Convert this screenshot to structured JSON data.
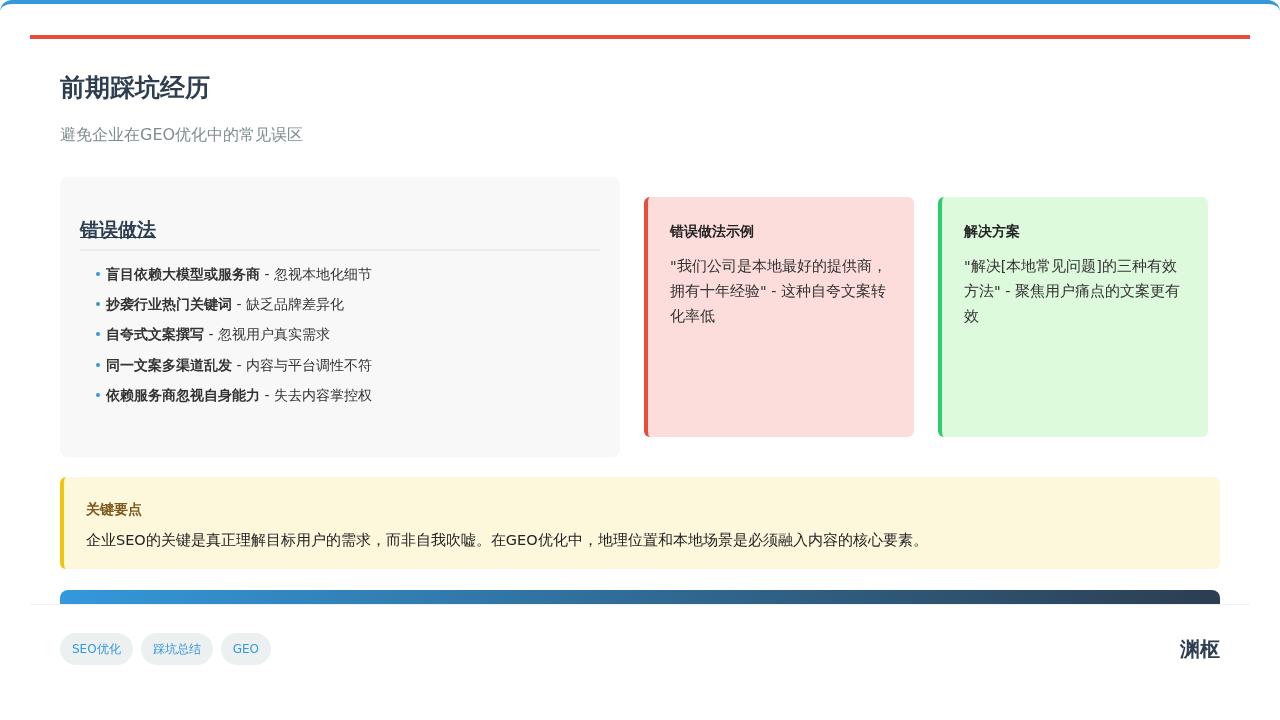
{
  "header": {
    "title": "前期踩坑经历",
    "subtitle": "避免企业在GEO优化中的常见误区"
  },
  "mistakes": {
    "heading": "错误做法",
    "items": [
      {
        "text": "**盲目依赖大模型或服务商** - 忽视本地化细节"
      },
      {
        "text": "**抄袭行业热门关键词** - 缺乏品牌差异化"
      },
      {
        "text": "**自夸式文案撰写** - 忽视用户真实需求"
      },
      {
        "text": "**同一文案多渠道乱发** - 内容与平台调性不符"
      },
      {
        "text": "**依赖服务商忽视自身能力** - 失去内容掌控权"
      }
    ]
  },
  "example_cards": [
    {
      "kind": "wrong",
      "title": "错误做法示例",
      "body": "\"我们公司是本地最好的提供商，拥有十年经验\" - 这种自夸文案转化率低"
    },
    {
      "kind": "solution",
      "title": "解决方案",
      "body": "\"解决[本地常见问题]的三种有效方法\" - 聚焦用户痛点的文案更有效"
    }
  ],
  "key_point": {
    "title": "关键要点",
    "body": "企业SEO的关键是真正理解目标用户的需求，而非自我吹嘘。在GEO优化中，地理位置和本地场景是必须融入内容的核心要素。"
  },
  "tags": [
    "SEO优化",
    "踩坑总结",
    "GEO"
  ],
  "brand": "渊枢"
}
